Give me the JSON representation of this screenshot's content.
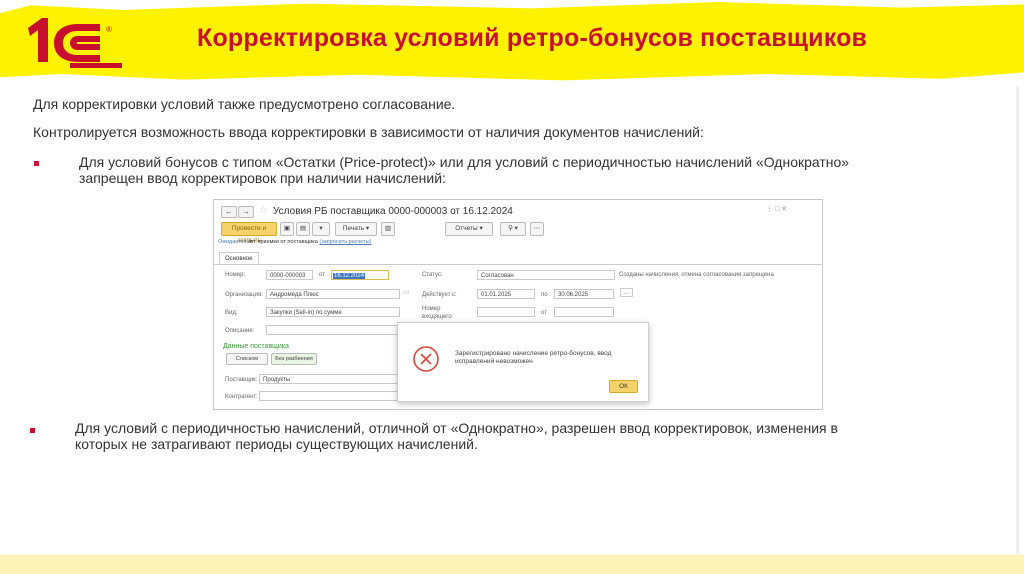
{
  "header": {
    "title": "Корректировка условий ретро-бонусов поставщиков",
    "logo_text": "1С",
    "logo_mark": "®"
  },
  "colors": {
    "accent": "#c8102e",
    "brush": "#fff200",
    "ok_button": "#f5d26a"
  },
  "body": {
    "intro_1": "Для корректировки условий также предусмотрено согласование.",
    "intro_2": "Контролируется возможность ввода корректировки в зависимости от наличия документов начислений:",
    "bullets": [
      {
        "line1": "Для условий бонусов с типом «Остатки (Price-protect)» или для условий с периодичностью начислений «Однократно»",
        "line2": "запрещен ввод корректировок при наличии начислений:"
      },
      {
        "line1": "Для условий с периодичностью начислений, отличной от «Однократно», разрешен ввод корректировок, изменения в",
        "line2": "которых не затрагивают периоды существующих начислений."
      }
    ]
  },
  "screenshot": {
    "window_title": "Условия РБ поставщика 0000-000003 от 16.12.2024",
    "toolbar": {
      "post_close": "Провести и закрыть",
      "print": "Печать",
      "reports": "Отчеты"
    },
    "approval_link_prefix": "Ожидается",
    "approval_link_text": "акт приемки от поставщика",
    "approval_link_suffix": "(запросить расчеты)",
    "tab_main": "Основное",
    "form": {
      "number_label": "Номер:",
      "number_value": "0000-000003",
      "from_label": "от",
      "date_value": "16.12.2024",
      "status_label": "Статус:",
      "status_value": "Согласован",
      "status_note": "Созданы начисления, отмена согласования запрещена",
      "org_label": "Организация:",
      "org_value": "Андромеда Плюс",
      "valid_label": "Действует с:",
      "valid_from": "01.01.2025",
      "to_label": "по",
      "valid_to": "30.06.2025",
      "kind_label": "Вид:",
      "kind_value": "Закупки (Sell-in) по сумме",
      "incoming_label": "Номер входящего документа:",
      "incoming_from": "от",
      "desc_label": "Описание:",
      "supplier_data": "Данные поставщика",
      "list_btn": "Списком",
      "no_split_btn": "Без разбиения",
      "supplier_label": "Поставщик:",
      "supplier_value": "Продукты",
      "contract_label": "Контрагент:"
    },
    "dialog": {
      "message_line1": "Зарегистрировано начисление ретро-бонусов, ввод",
      "message_line2": "исправлений невозможен",
      "ok": "ОК"
    }
  }
}
